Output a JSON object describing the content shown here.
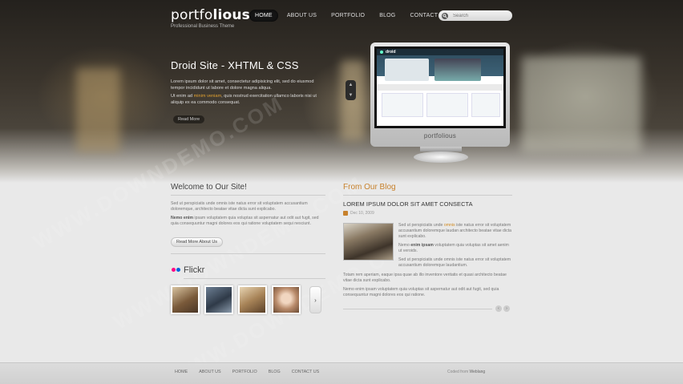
{
  "header": {
    "logo_prefix": "portfo",
    "logo_suffix": "lious",
    "tagline": "Professional Business Theme",
    "nav": [
      "HOME",
      "ABOUT US",
      "PORTFOLIO",
      "BLOG",
      "CONTACT US"
    ],
    "active_nav": "HOME",
    "search_placeholder": "Search"
  },
  "slider": {
    "title": "Droid Site - XHTML & CSS",
    "paragraph1": "Lorem ipsum dolor sit amet, consectetur adipisicing elit, sed do eiusmod tempor incididunt ut labore et dolore magna aliqua.",
    "paragraph2_pre": "Ut enim ad ",
    "paragraph2_hl": "minim veniam",
    "paragraph2_post": ", quis nostrud exercitation ullamco laboris nisi ut aliquip ex ea commodo consequat.",
    "read_more": "Read More",
    "monitor_brand": "portfolious",
    "screen_logo": "droid"
  },
  "welcome": {
    "heading": "Welcome to Our Site!",
    "p1": "Sed ut perspiciatis unde omnis iste natus error sit voluptatem accusantium doloremque, architecto beatae vitae dicta sunt explicabo.",
    "p2_bold": "Nemo enim",
    "p2": " ipsam voluptatem quia voluptas sit aspernatur aut odit aut fugit, sed quia consequuntur magni dolores eos qui ratione voluptatem sequi nesciunt.",
    "button": "Read More About Us"
  },
  "flickr": {
    "heading": "Flickr",
    "next": "›"
  },
  "blog": {
    "heading": "From Our Blog",
    "post_title": "LOREM IPSUM DOLOR SIT AMET CONSECTA",
    "date": "Dec 10, 2009",
    "p1_pre": "Sed ut perspiciatis unde ",
    "p1_hl": "omnis",
    "p1_post": " iste natus error sit voluptatem accusantium doloremque laudan architecto beatae vitae dicta sunt explicabo.",
    "p2_bold": "enim ipsam",
    "p2_pre": "Nemo ",
    "p2_post": " voluptatem quia voluptas sit amet aenim ut veroids.",
    "p3": "Sed ut perspiciatis unde omnis iste natus error sit voluptatem accusantium doloremque laudantium.",
    "p4": "Totam rem aperiam, eaque ipsa quae ab illo inventore veritatis et quasi architecto beatae vitae dicta sunt explicabo.",
    "p5": "Nemo enim ipsam voluptatem quia voluptas sit aspernatur aut odit aut fugit, sed quia consequuntur magni dolores eos qui ratione.",
    "prev": "‹",
    "next": "›"
  },
  "footer": {
    "nav": [
      "HOME",
      "ABOUT US",
      "PORTFOLIO",
      "BLOG",
      "CONTACT US"
    ],
    "copy_pre": "Coded from ",
    "copy_link": "Weblang"
  },
  "watermark": "WWW.DOWNDEMO.COM",
  "colors": {
    "accent": "#c7812c",
    "hero_dark": "#24211d",
    "page_bg": "#e9e9e9"
  }
}
